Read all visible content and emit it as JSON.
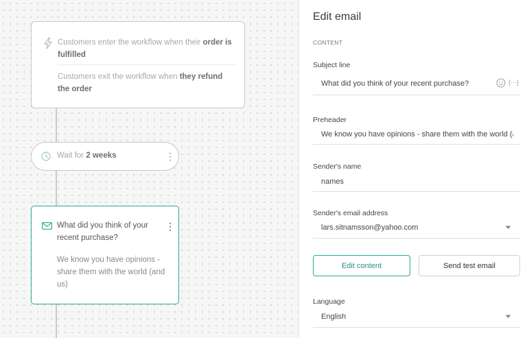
{
  "canvas": {
    "trigger": {
      "enter_prefix": "Customers enter the workflow when their ",
      "enter_bold": "order is fulfilled",
      "exit_prefix": "Customers exit the workflow when ",
      "exit_bold": "they refund the order",
      "icon": "lightning-icon"
    },
    "wait": {
      "prefix": "Wait for ",
      "bold": "2 weeks",
      "icon": "clock-icon"
    },
    "email": {
      "title": "What did you think of your recent purchase?",
      "preview": "We know you have opinions - share them with the world (and us)",
      "icon": "envelope-icon"
    },
    "menu_glyph": "⋮"
  },
  "panel": {
    "title": "Edit email",
    "section": "CONTENT",
    "subject": {
      "label": "Subject line",
      "value": "What did you think of your recent purchase?",
      "var_glyph": "{···}"
    },
    "preheader": {
      "label": "Preheader",
      "value": "We know you have opinions - share them with the world (and us)"
    },
    "sender_name": {
      "label": "Sender's name",
      "value": "names"
    },
    "sender_email": {
      "label": "Sender's email address",
      "value": "lars.sitnamsson@yahoo.com"
    },
    "buttons": {
      "edit": "Edit content",
      "test": "Send test email"
    },
    "language": {
      "label": "Language",
      "value": "English"
    }
  },
  "colors": {
    "accent": "#2aa89a",
    "canvas_bg": "#f6f6f6",
    "card_border": "#c8c8c8"
  }
}
